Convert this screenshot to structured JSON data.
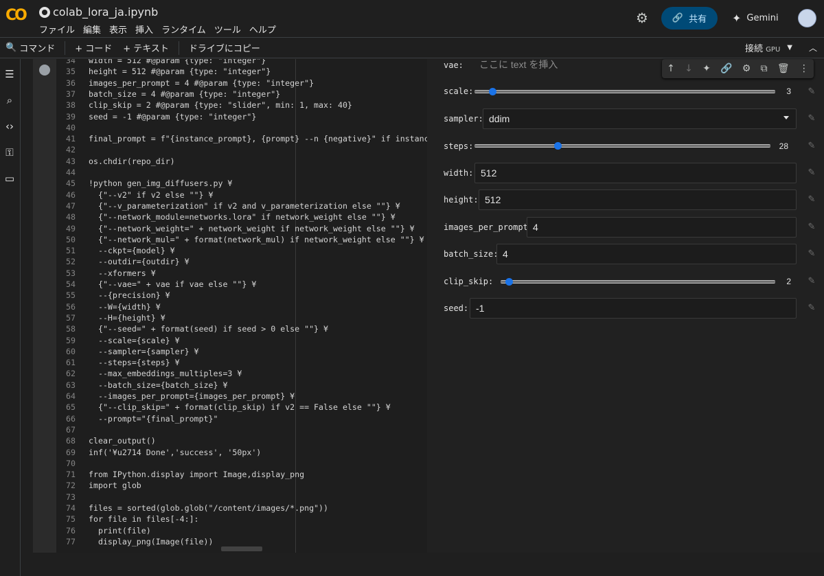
{
  "app": {
    "logo_text": "CO",
    "title": "colab_lora_ja.ipynb",
    "menu": [
      "ファイル",
      "編集",
      "表示",
      "挿入",
      "ランタイム",
      "ツール",
      "ヘルプ"
    ],
    "share_label": "共有",
    "gemini_label": "Gemini"
  },
  "toolbar": {
    "command_label": "コマンド",
    "add_code_label": "+ コード",
    "add_text_label": "+ テキスト",
    "copy_drive_label": "ドライブにコピー",
    "connect_label": "接続",
    "gpu_label": "GPU"
  },
  "colors": {
    "accent": "#1a73e8",
    "share_bg": "#004a77",
    "logo_orange": "#f9ab00"
  },
  "code_lines": [
    {
      "n": "34",
      "t": "width = 512 #@param {type: \"integer\"}"
    },
    {
      "n": "35",
      "t": "height = 512 #@param {type: \"integer\"}"
    },
    {
      "n": "36",
      "t": "images_per_prompt = 4 #@param {type: \"integer\"}"
    },
    {
      "n": "37",
      "t": "batch_size = 4 #@param {type: \"integer\"}"
    },
    {
      "n": "38",
      "t": "clip_skip = 2 #@param {type: \"slider\", min: 1, max: 40}"
    },
    {
      "n": "39",
      "t": "seed = -1 #@param {type: \"integer\"}"
    },
    {
      "n": "40",
      "t": ""
    },
    {
      "n": "41",
      "t": "final_prompt = f\"{instance_prompt}, {prompt} --n {negative}\" if instance_prompt e"
    },
    {
      "n": "42",
      "t": ""
    },
    {
      "n": "43",
      "t": "os.chdir(repo_dir)"
    },
    {
      "n": "44",
      "t": ""
    },
    {
      "n": "45",
      "t": "!python gen_img_diffusers.py ¥"
    },
    {
      "n": "46",
      "t": "  {\"--v2\" if v2 else \"\"} ¥"
    },
    {
      "n": "47",
      "t": "  {\"--v_parameterization\" if v2 and v_parameterization else \"\"} ¥"
    },
    {
      "n": "48",
      "t": "  {\"--network_module=networks.lora\" if network_weight else \"\"} ¥"
    },
    {
      "n": "49",
      "t": "  {\"--network_weight=\" + network_weight if network_weight else \"\"} ¥"
    },
    {
      "n": "50",
      "t": "  {\"--network_mul=\" + format(network_mul) if network_weight else \"\"} ¥"
    },
    {
      "n": "51",
      "t": "  --ckpt={model} ¥"
    },
    {
      "n": "52",
      "t": "  --outdir={outdir} ¥"
    },
    {
      "n": "53",
      "t": "  --xformers ¥"
    },
    {
      "n": "54",
      "t": "  {\"--vae=\" + vae if vae else \"\"} ¥"
    },
    {
      "n": "55",
      "t": "  --{precision} ¥"
    },
    {
      "n": "56",
      "t": "  --W={width} ¥"
    },
    {
      "n": "57",
      "t": "  --H={height} ¥"
    },
    {
      "n": "58",
      "t": "  {\"--seed=\" + format(seed) if seed > 0 else \"\"} ¥"
    },
    {
      "n": "59",
      "t": "  --scale={scale} ¥"
    },
    {
      "n": "60",
      "t": "  --sampler={sampler} ¥"
    },
    {
      "n": "61",
      "t": "  --steps={steps} ¥"
    },
    {
      "n": "62",
      "t": "  --max_embeddings_multiples=3 ¥"
    },
    {
      "n": "63",
      "t": "  --batch_size={batch_size} ¥"
    },
    {
      "n": "64",
      "t": "  --images_per_prompt={images_per_prompt} ¥"
    },
    {
      "n": "65",
      "t": "  {\"--clip_skip=\" + format(clip_skip) if v2 == False else \"\"} ¥"
    },
    {
      "n": "66",
      "t": "  --prompt=\"{final_prompt}\""
    },
    {
      "n": "67",
      "t": ""
    },
    {
      "n": "68",
      "t": "clear_output()"
    },
    {
      "n": "69",
      "t": "inf('¥u2714 Done','success', '50px')"
    },
    {
      "n": "70",
      "t": ""
    },
    {
      "n": "71",
      "t": "from IPython.display import Image,display_png"
    },
    {
      "n": "72",
      "t": "import glob"
    },
    {
      "n": "73",
      "t": ""
    },
    {
      "n": "74",
      "t": "files = sorted(glob.glob(\"/content/images/*.png\"))"
    },
    {
      "n": "75",
      "t": "for file in files[-4:]:"
    },
    {
      "n": "76",
      "t": "  print(file)"
    },
    {
      "n": "77",
      "t": "  display_png(Image(file))"
    }
  ],
  "form": {
    "vae": {
      "label": "vae:",
      "placeholder": "ここに text を挿入"
    },
    "scale": {
      "label": "scale:",
      "value": "3",
      "fraction": 0.06
    },
    "sampler": {
      "label": "sampler:",
      "value": "ddim"
    },
    "steps": {
      "label": "steps:",
      "value": "28",
      "fraction": 0.28
    },
    "width": {
      "label": "width:",
      "value": "512"
    },
    "height": {
      "label": "height:",
      "value": "512"
    },
    "images_per_prompt": {
      "label": "images_per_prompt:",
      "value": "4"
    },
    "batch_size": {
      "label": "batch_size:",
      "value": "4"
    },
    "clip_skip": {
      "label": "clip_skip:",
      "value": "2",
      "fraction": 0.03
    },
    "seed": {
      "label": "seed:",
      "value": "-1"
    }
  }
}
